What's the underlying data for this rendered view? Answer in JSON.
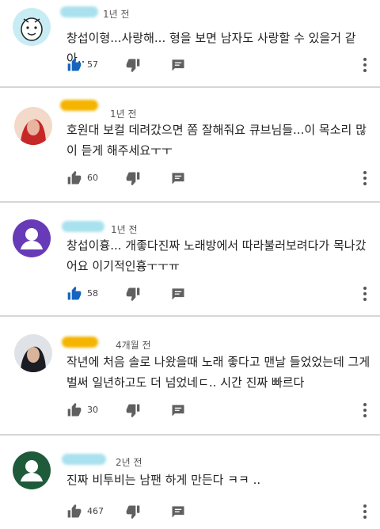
{
  "comments": [
    {
      "time": "1년 전",
      "text": "창섭이형...사랑해... 형을 보면 남자도 사랑할 수 있을거 같아..",
      "likes": "57",
      "liked": true,
      "avatar_icon": "cartoon-avatar-icon",
      "name_blur_color": "#a9e1ee"
    },
    {
      "time": "1년 전",
      "text": "호원대 보컬 데려갔으면 쫌 잘해줘요 큐브님들...이 목소리 많이 듣게 해주세요ㅜㅜ",
      "likes": "60",
      "liked": false,
      "avatar_icon": "photo-avatar-icon",
      "name_blur_color": "#f4b400"
    },
    {
      "time": "1년 전",
      "text": "창섭이흉... 개좋다진짜 노래방에서 따라불러보려다가 목나갔어요 이기적인흉ㅜㅜㅠ",
      "likes": "58",
      "liked": true,
      "avatar_icon": "default-avatar-icon",
      "name_blur_color": "#a9e1ee"
    },
    {
      "time": "4개월 전",
      "text": "작년에 처음 솔로 나왔을때 노래 좋다고 맨날 들었었는데 그게 벌써 일년하고도 더 넘었네ㄷ.. 시간 진짜 빠르다",
      "likes": "30",
      "liked": false,
      "avatar_icon": "photo-avatar-icon",
      "name_blur_color": "#f4b400"
    },
    {
      "time": "2년 전",
      "text": "진짜 비투비는 남팬 하게 만든다 ㅋㅋ ..",
      "likes": "467",
      "liked": false,
      "avatar_icon": "default-avatar-icon",
      "name_blur_color": "#a9e1ee"
    }
  ],
  "colors": {
    "like_active": "#1565c0",
    "icon_gray": "#606060",
    "default_avatar_bg": "#673ab7",
    "default_avatar_bg_alt": "#1e5b3a"
  }
}
